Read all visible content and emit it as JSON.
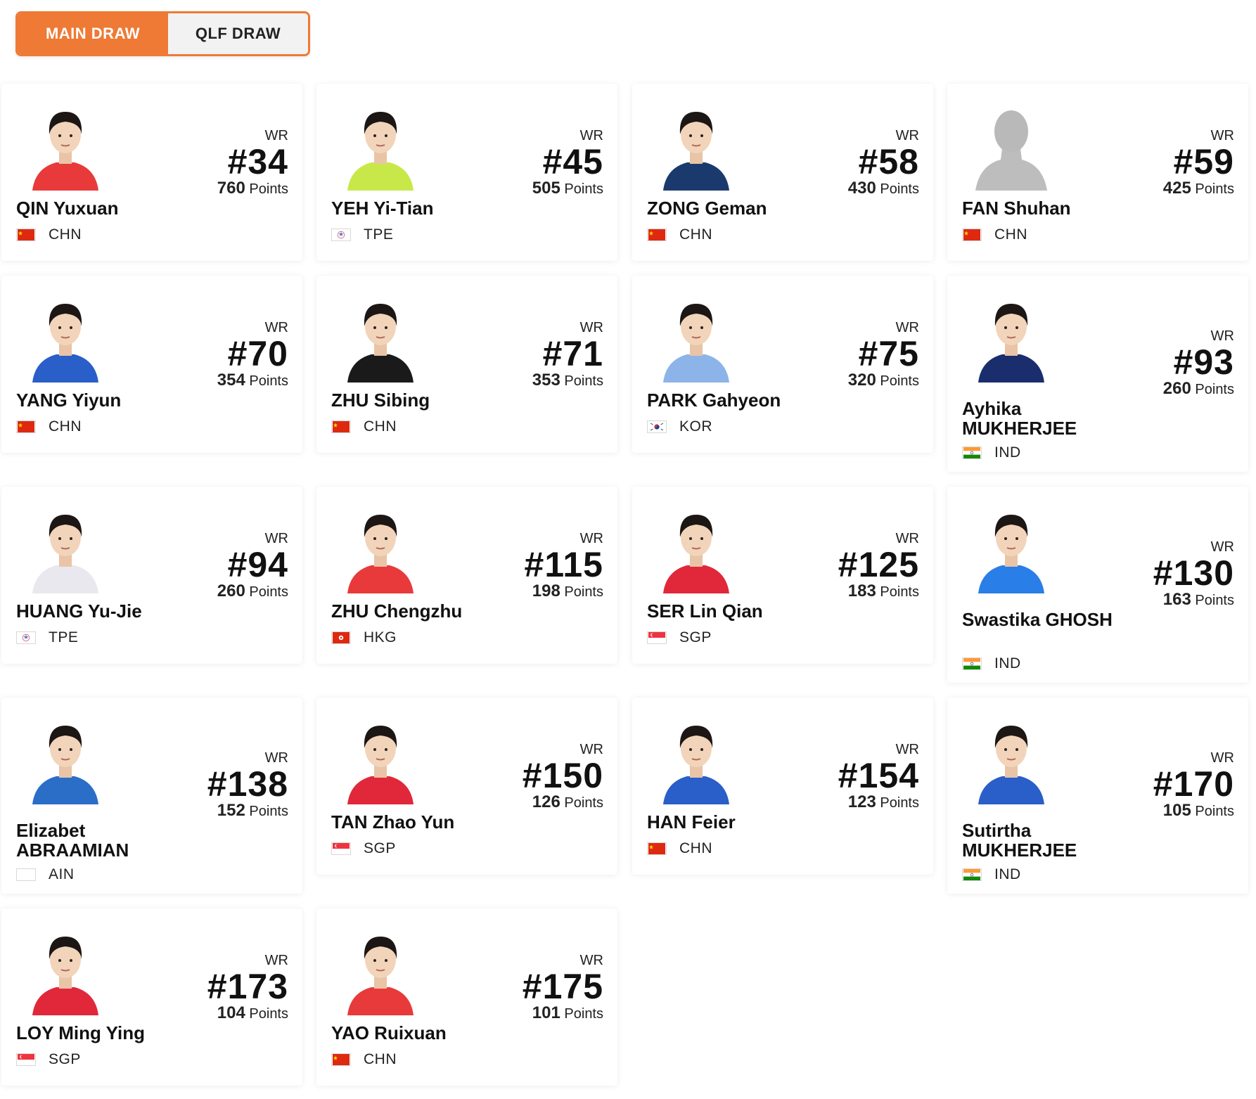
{
  "tabs": {
    "main_draw": "MAIN DRAW",
    "qlf_draw": "QLF DRAW"
  },
  "labels": {
    "wr": "WR",
    "points": "Points"
  },
  "colors": {
    "accent": "#ee7a35"
  },
  "players": [
    {
      "name": "QIN Yuxuan",
      "country": "CHN",
      "flag": "chn",
      "rank": "#34",
      "points": "760",
      "shirt": "#e83a3a",
      "photo": "photo"
    },
    {
      "name": "YEH Yi-Tian",
      "country": "TPE",
      "flag": "tpe",
      "rank": "#45",
      "points": "505",
      "shirt": "#c8e84a",
      "photo": "photo"
    },
    {
      "name": "ZONG Geman",
      "country": "CHN",
      "flag": "chn",
      "rank": "#58",
      "points": "430",
      "shirt": "#1a3a6e",
      "photo": "photo"
    },
    {
      "name": "FAN Shuhan",
      "country": "CHN",
      "flag": "chn",
      "rank": "#59",
      "points": "425",
      "shirt": "#c8c8c8",
      "photo": "placeholder"
    },
    {
      "name": "YANG Yiyun",
      "country": "CHN",
      "flag": "chn",
      "rank": "#70",
      "points": "354",
      "shirt": "#2a5ec8",
      "photo": "photo"
    },
    {
      "name": "ZHU Sibing",
      "country": "CHN",
      "flag": "chn",
      "rank": "#71",
      "points": "353",
      "shirt": "#1a1a1a",
      "photo": "photo"
    },
    {
      "name": "PARK Gahyeon",
      "country": "KOR",
      "flag": "kor",
      "rank": "#75",
      "points": "320",
      "shirt": "#8cb4e8",
      "photo": "photo"
    },
    {
      "name": "Ayhika MUKHERJEE",
      "country": "IND",
      "flag": "ind",
      "rank": "#93",
      "points": "260",
      "shirt": "#1a2e6e",
      "photo": "photo"
    },
    {
      "name": "HUANG Yu-Jie",
      "country": "TPE",
      "flag": "tpe",
      "rank": "#94",
      "points": "260",
      "shirt": "#e8e8ee",
      "photo": "photo"
    },
    {
      "name": "ZHU Chengzhu",
      "country": "HKG",
      "flag": "hkg",
      "rank": "#115",
      "points": "198",
      "shirt": "#e83a3a",
      "photo": "photo"
    },
    {
      "name": "SER Lin Qian",
      "country": "SGP",
      "flag": "sgp",
      "rank": "#125",
      "points": "183",
      "shirt": "#e0283a",
      "photo": "photo"
    },
    {
      "name": "Swastika GHOSH",
      "country": "IND",
      "flag": "ind",
      "rank": "#130",
      "points": "163",
      "shirt": "#2a7ee8",
      "photo": "photo"
    },
    {
      "name": "Elizabet ABRAAMIAN",
      "country": "AIN",
      "flag": "ain",
      "rank": "#138",
      "points": "152",
      "shirt": "#2a6ec8",
      "photo": "photo"
    },
    {
      "name": "TAN Zhao Yun",
      "country": "SGP",
      "flag": "sgp",
      "rank": "#150",
      "points": "126",
      "shirt": "#e0283a",
      "photo": "photo"
    },
    {
      "name": "HAN Feier",
      "country": "CHN",
      "flag": "chn",
      "rank": "#154",
      "points": "123",
      "shirt": "#2a5ec8",
      "photo": "photo"
    },
    {
      "name": "Sutirtha MUKHERJEE",
      "country": "IND",
      "flag": "ind",
      "rank": "#170",
      "points": "105",
      "shirt": "#2a5ec8",
      "photo": "photo"
    },
    {
      "name": "LOY Ming Ying",
      "country": "SGP",
      "flag": "sgp",
      "rank": "#173",
      "points": "104",
      "shirt": "#e0283a",
      "photo": "photo"
    },
    {
      "name": "YAO Ruixuan",
      "country": "CHN",
      "flag": "chn",
      "rank": "#175",
      "points": "101",
      "shirt": "#e83a3a",
      "photo": "photo"
    }
  ]
}
